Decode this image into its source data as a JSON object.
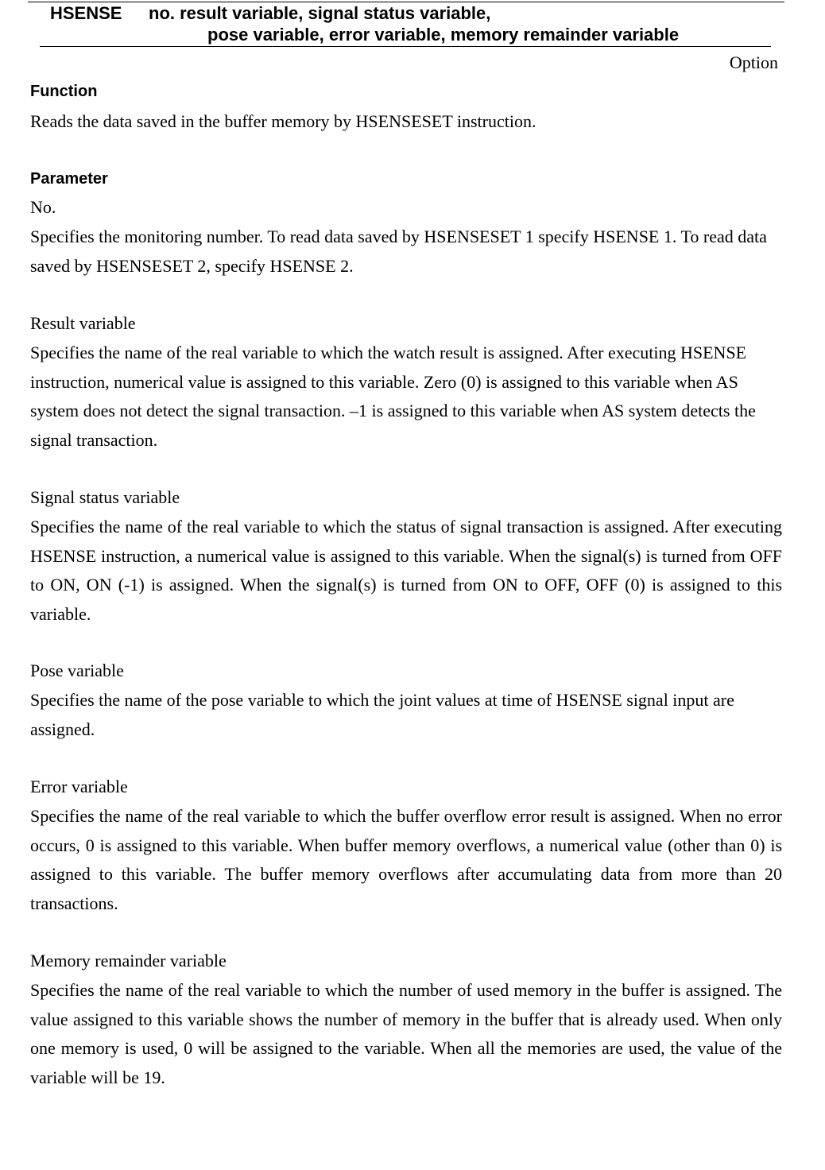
{
  "header": {
    "command": "HSENSE",
    "syntax_line1": "no. result variable, signal status variable,",
    "syntax_line2": "pose variable, error variable, memory remainder variable",
    "option_label": "Option"
  },
  "function_section": {
    "heading": "Function",
    "text": "Reads the data saved in the buffer memory by HSENSESET instruction."
  },
  "parameter_section": {
    "heading": "Parameter",
    "params": [
      {
        "title": "No.",
        "text": "Specifies the monitoring number.    To read data saved by HSENSESET 1 specify HSENSE 1. To read data saved by HSENSESET 2, specify HSENSE 2."
      },
      {
        "title": "Result variable",
        "text": "Specifies the name of the real variable to which the watch result is assigned.    After executing HSENSE instruction, numerical value is assigned to this variable.    Zero (0) is assigned to this variable when AS system does not detect the signal transaction.    –1 is assigned to this variable when AS system detects the signal transaction."
      },
      {
        "title": "Signal status variable",
        "text": "Specifies the name of the real variable to which the status of signal transaction is assigned. After executing HSENSE instruction, a numerical value is assigned to this variable. When the signal(s) is turned from OFF to ON, ON (-1) is assigned. When the signal(s) is turned from ON to OFF, OFF (0) is assigned to this variable."
      },
      {
        "title": "Pose variable",
        "text": "Specifies the name of the pose variable to which the joint values at time of HSENSE signal input are assigned."
      },
      {
        "title": "Error variable",
        "text": "Specifies the name of the real variable to which the buffer overflow error result is assigned. When no error occurs, 0 is assigned to this variable. When buffer memory overflows, a numerical value (other than 0) is assigned to this variable. The buffer memory overflows after accumulating data from more than 20 transactions."
      },
      {
        "title": "Memory remainder variable",
        "text": "Specifies the name of the real variable to which the number of used memory in the buffer is assigned.  The value assigned to this variable shows the number of memory in the buffer that is already used.  When only one memory is used, 0 will be assigned to the variable.    When all the memories are used, the value of the variable will be 19."
      }
    ]
  }
}
